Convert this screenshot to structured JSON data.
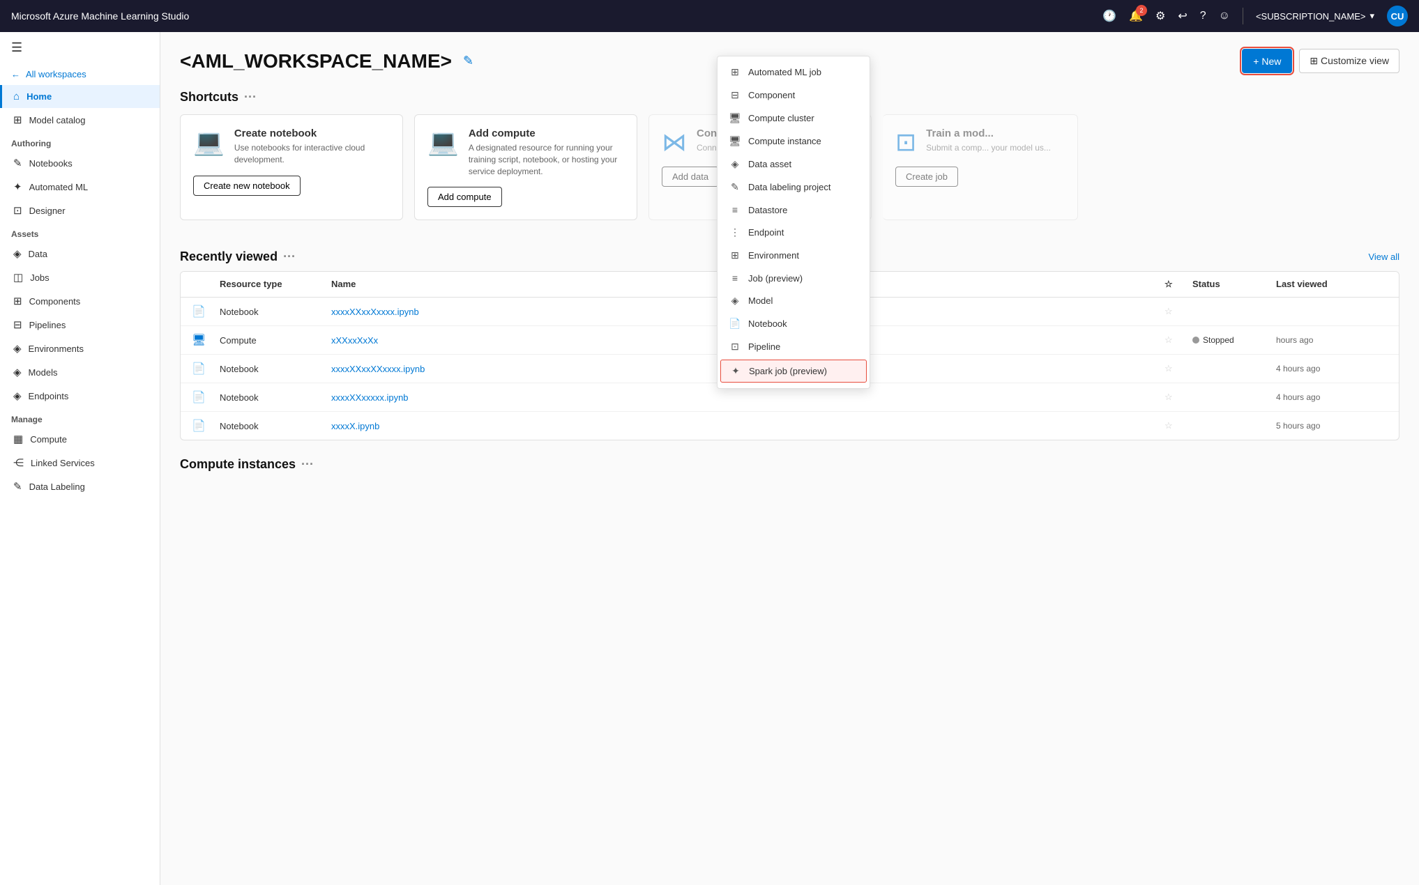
{
  "app": {
    "title": "Microsoft Azure Machine Learning Studio"
  },
  "topbar": {
    "title": "Microsoft Azure Machine Learning Studio",
    "notification_count": "2",
    "subscription_label": "<SUBSCRIPTION_NAME>",
    "avatar_initials": "CU"
  },
  "sidebar": {
    "hamburger_icon": "☰",
    "back_label": "All workspaces",
    "nav_items": [
      {
        "id": "home",
        "label": "Home",
        "icon": "⌂",
        "active": true,
        "section": null
      },
      {
        "id": "model-catalog",
        "label": "Model catalog",
        "icon": "⊞",
        "active": false,
        "section": null
      },
      {
        "id": "authoring-header",
        "label": "Authoring",
        "is_header": true
      },
      {
        "id": "notebooks",
        "label": "Notebooks",
        "icon": "✎",
        "active": false
      },
      {
        "id": "automated-ml",
        "label": "Automated ML",
        "icon": "✦",
        "active": false
      },
      {
        "id": "designer",
        "label": "Designer",
        "icon": "⊡",
        "active": false
      },
      {
        "id": "assets-header",
        "label": "Assets",
        "is_header": true
      },
      {
        "id": "data",
        "label": "Data",
        "icon": "◈",
        "active": false
      },
      {
        "id": "jobs",
        "label": "Jobs",
        "icon": "◫",
        "active": false
      },
      {
        "id": "components",
        "label": "Components",
        "icon": "⊞",
        "active": false
      },
      {
        "id": "pipelines",
        "label": "Pipelines",
        "icon": "⊟",
        "active": false
      },
      {
        "id": "environments",
        "label": "Environments",
        "icon": "◈",
        "active": false
      },
      {
        "id": "models",
        "label": "Models",
        "icon": "◈",
        "active": false
      },
      {
        "id": "endpoints",
        "label": "Endpoints",
        "icon": "◈",
        "active": false
      },
      {
        "id": "manage-header",
        "label": "Manage",
        "is_header": true
      },
      {
        "id": "compute",
        "label": "Compute",
        "icon": "▦",
        "active": false
      },
      {
        "id": "linked-services",
        "label": "Linked Services",
        "icon": "⋲",
        "active": false
      },
      {
        "id": "data-labeling",
        "label": "Data Labeling",
        "icon": "✎",
        "active": false
      }
    ]
  },
  "main": {
    "workspace_name": "<AML_WORKSPACE_NAME>",
    "edit_icon": "✎",
    "new_button_label": "+ New",
    "customize_view_label": "⊞ Customize view",
    "shortcuts_title": "Shortcuts",
    "shortcuts_more_icon": "···",
    "shortcuts": [
      {
        "id": "create-notebook",
        "icon": "💻",
        "title": "Create notebook",
        "description": "Use notebooks for interactive cloud development.",
        "button_label": "Create new notebook"
      },
      {
        "id": "add-compute",
        "icon": "💻",
        "title": "Add compute",
        "description": "A designated resource for running your training script, notebook, or hosting your service deployment.",
        "button_label": "Add compute"
      },
      {
        "id": "connect-data",
        "icon": "⋈",
        "title": "Connect da...",
        "description": "Connect data files, public U... assets.",
        "button_label": "Add data"
      },
      {
        "id": "train-model",
        "icon": "⊡",
        "title": "Train a mod...",
        "description": "Submit a comp... your model us...",
        "button_label": "Create job"
      }
    ],
    "carousel_dots": [
      {
        "active": true
      },
      {
        "active": false
      }
    ],
    "recently_viewed_title": "Recently viewed",
    "recently_viewed_more": "···",
    "view_all_label": "View all",
    "table_headers": [
      {
        "id": "icon",
        "label": ""
      },
      {
        "id": "resource_type",
        "label": "Resource type"
      },
      {
        "id": "name",
        "label": "Name"
      },
      {
        "id": "star",
        "label": "☆"
      },
      {
        "id": "status",
        "label": "Status"
      },
      {
        "id": "last_viewed",
        "label": "Last viewed"
      }
    ],
    "table_rows": [
      {
        "icon": "📄",
        "resource_type": "Notebook",
        "name": "xxxxXXxxXxxxx.ipynb",
        "starred": false,
        "status": "",
        "last_viewed": ""
      },
      {
        "icon": "🖥",
        "resource_type": "Compute",
        "name": "xXXxxXxXx",
        "starred": false,
        "status": "Stopped",
        "last_viewed": "hours ago"
      },
      {
        "icon": "📄",
        "resource_type": "Notebook",
        "name": "xxxxXXxxXXxxxx.ipynb",
        "starred": false,
        "status": "",
        "last_viewed": "4 hours ago"
      },
      {
        "icon": "📄",
        "resource_type": "Notebook",
        "name": "xxxxXXxxxxx.ipynb",
        "starred": false,
        "status": "",
        "last_viewed": "4 hours ago"
      },
      {
        "icon": "📄",
        "resource_type": "Notebook",
        "name": "xxxxX.ipynb",
        "starred": false,
        "status": "",
        "last_viewed": "5 hours ago"
      }
    ],
    "compute_instances_title": "Compute instances",
    "compute_instances_more": "···"
  },
  "dropdown": {
    "items": [
      {
        "id": "automated-ml-job",
        "icon": "⊞",
        "label": "Automated ML job",
        "highlighted": false
      },
      {
        "id": "component",
        "icon": "⊟",
        "label": "Component",
        "highlighted": false
      },
      {
        "id": "compute-cluster",
        "icon": "🖥",
        "label": "Compute cluster",
        "highlighted": false
      },
      {
        "id": "compute-instance",
        "icon": "🖥",
        "label": "Compute instance",
        "highlighted": false
      },
      {
        "id": "data-asset",
        "icon": "◈",
        "label": "Data asset",
        "highlighted": false
      },
      {
        "id": "data-labeling-project",
        "icon": "✎",
        "label": "Data labeling project",
        "highlighted": false
      },
      {
        "id": "datastore",
        "icon": "≡",
        "label": "Datastore",
        "highlighted": false
      },
      {
        "id": "endpoint",
        "icon": "⋮",
        "label": "Endpoint",
        "highlighted": false
      },
      {
        "id": "environment",
        "icon": "⊞",
        "label": "Environment",
        "highlighted": false
      },
      {
        "id": "job-preview",
        "icon": "≡",
        "label": "Job (preview)",
        "highlighted": false
      },
      {
        "id": "model",
        "icon": "◈",
        "label": "Model",
        "highlighted": false
      },
      {
        "id": "notebook",
        "icon": "📄",
        "label": "Notebook",
        "highlighted": false
      },
      {
        "id": "pipeline",
        "icon": "⊡",
        "label": "Pipeline",
        "highlighted": false
      },
      {
        "id": "spark-job-preview",
        "icon": "✦",
        "label": "Spark job (preview)",
        "highlighted": true
      }
    ]
  },
  "colors": {
    "brand_blue": "#0078d4",
    "highlight_red": "#e74c3c",
    "sidebar_active_border": "#0078d4",
    "sidebar_active_bg": "#e8f3ff"
  }
}
